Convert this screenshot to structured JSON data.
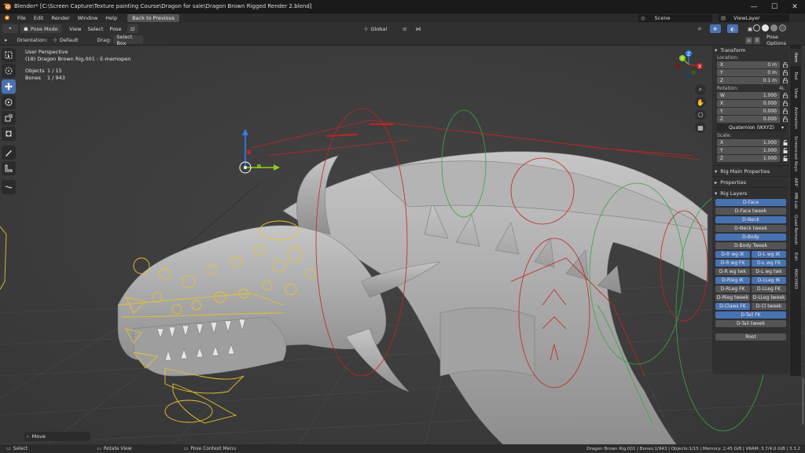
{
  "window": {
    "title": "Blender* [C:\\Screen Capture\\Texture painting Course\\Dragon for sale\\Dragon Brown Rigged Render 2.blend]",
    "minimize_glyph": "—",
    "maximize_glyph": "☐",
    "close_glyph": "✕"
  },
  "menubar": {
    "items": [
      "File",
      "Edit",
      "Render",
      "Window",
      "Help"
    ],
    "back_button": "Back to Previous",
    "scene": "Scene",
    "view_layer": "ViewLayer"
  },
  "header": {
    "mode": "Pose Mode",
    "menus": [
      "View",
      "Select",
      "Pose"
    ],
    "transform_orientation": "Global",
    "pose_options": "Pose Options"
  },
  "toolrow": {
    "orientation_label": "Orientation:",
    "orientation_value": "Default",
    "drag_label": "Drag:",
    "drag_value": "Select Box"
  },
  "viewport": {
    "perspective": "User Perspective",
    "active_object": "(18) Dragon Brown Rig.001 : E-memopen",
    "objects_label": "Objects",
    "objects_value": "1 / 15",
    "bones_label": "Bones",
    "bones_value": "1 / 943"
  },
  "npanel": {
    "transform_header": "Transform",
    "location_label": "Location:",
    "location": [
      {
        "axis": "X",
        "value": "0 m"
      },
      {
        "axis": "Y",
        "value": "0 m"
      },
      {
        "axis": "Z",
        "value": "0.1 m"
      }
    ],
    "rotation_label": "Rotation:",
    "rotation_mode_short": "4L",
    "rotation": [
      {
        "axis": "W",
        "value": "1.000"
      },
      {
        "axis": "X",
        "value": "0.000"
      },
      {
        "axis": "Y",
        "value": "0.000"
      },
      {
        "axis": "Z",
        "value": "0.000"
      }
    ],
    "rotation_mode": "Quaternion (WXYZ)",
    "scale_label": "Scale:",
    "scale": [
      {
        "axis": "X",
        "value": "1.000"
      },
      {
        "axis": "Y",
        "value": "1.000"
      },
      {
        "axis": "Z",
        "value": "1.000"
      }
    ],
    "rig_main_properties": "Rig Main Properties",
    "properties": "Properties",
    "rig_layers": "Rig Layers",
    "layers_single_1": [
      {
        "label": "D-Face",
        "on": true
      },
      {
        "label": "D-Face tweek",
        "on": false
      },
      {
        "label": "D-Neck",
        "on": true
      },
      {
        "label": "D-Neck tweek",
        "on": false
      },
      {
        "label": "D-Body",
        "on": true
      },
      {
        "label": "D-Body Tweek",
        "on": false
      }
    ],
    "layers_pairs": [
      [
        {
          "label": "D-R wg IK",
          "on": true
        },
        {
          "label": "D-L wg IK",
          "on": true
        }
      ],
      [
        {
          "label": "D-R wg FK",
          "on": true
        },
        {
          "label": "D-L wg FK",
          "on": true
        }
      ],
      [
        {
          "label": "D-R wg twk",
          "on": false
        },
        {
          "label": "D-L wg twk",
          "on": false
        }
      ],
      [
        {
          "label": "D-Rleg IK",
          "on": true
        },
        {
          "label": "D-LLeg IK",
          "on": true
        }
      ],
      [
        {
          "label": "D-RLeg FK",
          "on": false
        },
        {
          "label": "D-LLeg FK",
          "on": false
        }
      ],
      [
        {
          "label": "D-Rleg tweek",
          "on": false
        },
        {
          "label": "D-LLeg tweek",
          "on": false
        }
      ],
      [
        {
          "label": "D-Claws FK",
          "on": true
        },
        {
          "label": "D-Cl tweek",
          "on": false
        }
      ]
    ],
    "layers_single_2": [
      {
        "label": "D-Tail FK",
        "on": true
      },
      {
        "label": "D-Tail tweek",
        "on": false
      }
    ],
    "root": "Root"
  },
  "tabs": [
    "Item",
    "Tool",
    "View",
    "Animation",
    "Screencast Keys",
    "ARP",
    "MB-Lab",
    "Quad Remesh",
    "Edit",
    "MACHIN3"
  ],
  "last_operator": "Move",
  "statusbar": {
    "select": "Select",
    "rotate_view": "Rotate View",
    "context_menu": "Pose Context Menu",
    "info": "Dragon Brown Rig.001 | Bones:1/943 | Objects:1/15 | Memory: 2.45 GiB | VRAM: 3.7/4.0 GiB | 3.3.2"
  },
  "colors": {
    "accent": "#4772b3",
    "bone_selected": "#e8c32a",
    "bone_red": "#c42424",
    "bone_green": "#33a844",
    "mesh": "#a8a8a8"
  }
}
